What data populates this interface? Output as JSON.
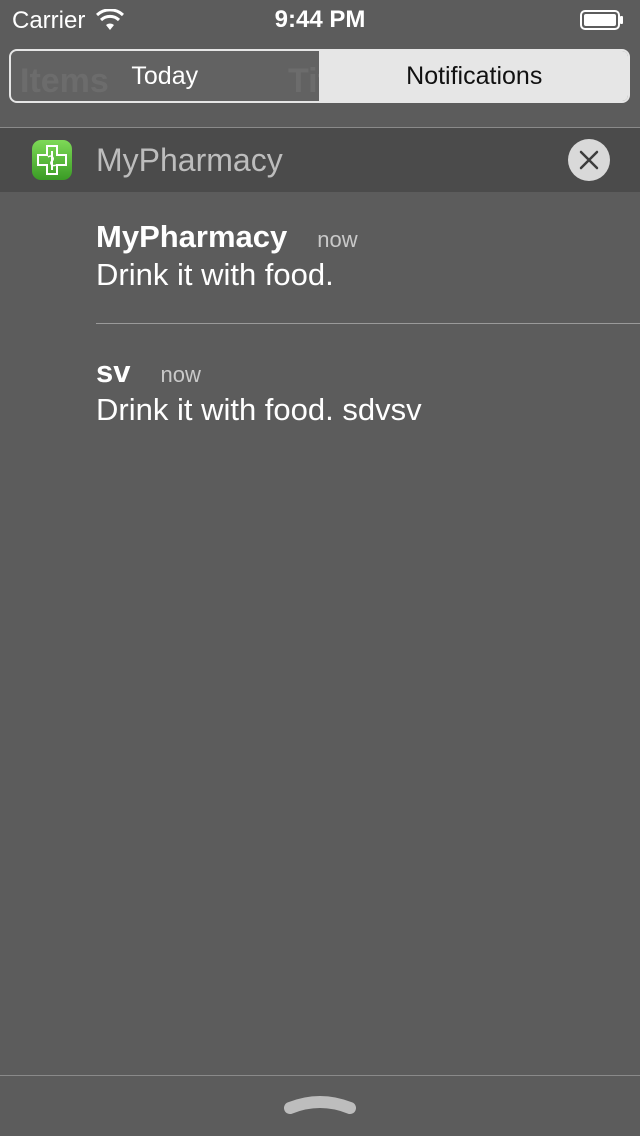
{
  "status_bar": {
    "carrier": "Carrier",
    "time": "9:44 PM"
  },
  "background_app": {
    "left_text": "Items",
    "center_text": "Title",
    "right_symbol": "+"
  },
  "segmented_control": {
    "today_label": "Today",
    "notifications_label": "Notifications",
    "selected": "Notifications"
  },
  "app_group": {
    "app_name": "MyPharmacy",
    "icon": "pharmacy-cross-icon",
    "accent_color": "#4caf33"
  },
  "notifications": [
    {
      "title": "MyPharmacy",
      "time": "now",
      "message": "Drink it with food."
    },
    {
      "title": "sv",
      "time": "now",
      "message": "Drink it with food. sdvsv"
    }
  ]
}
